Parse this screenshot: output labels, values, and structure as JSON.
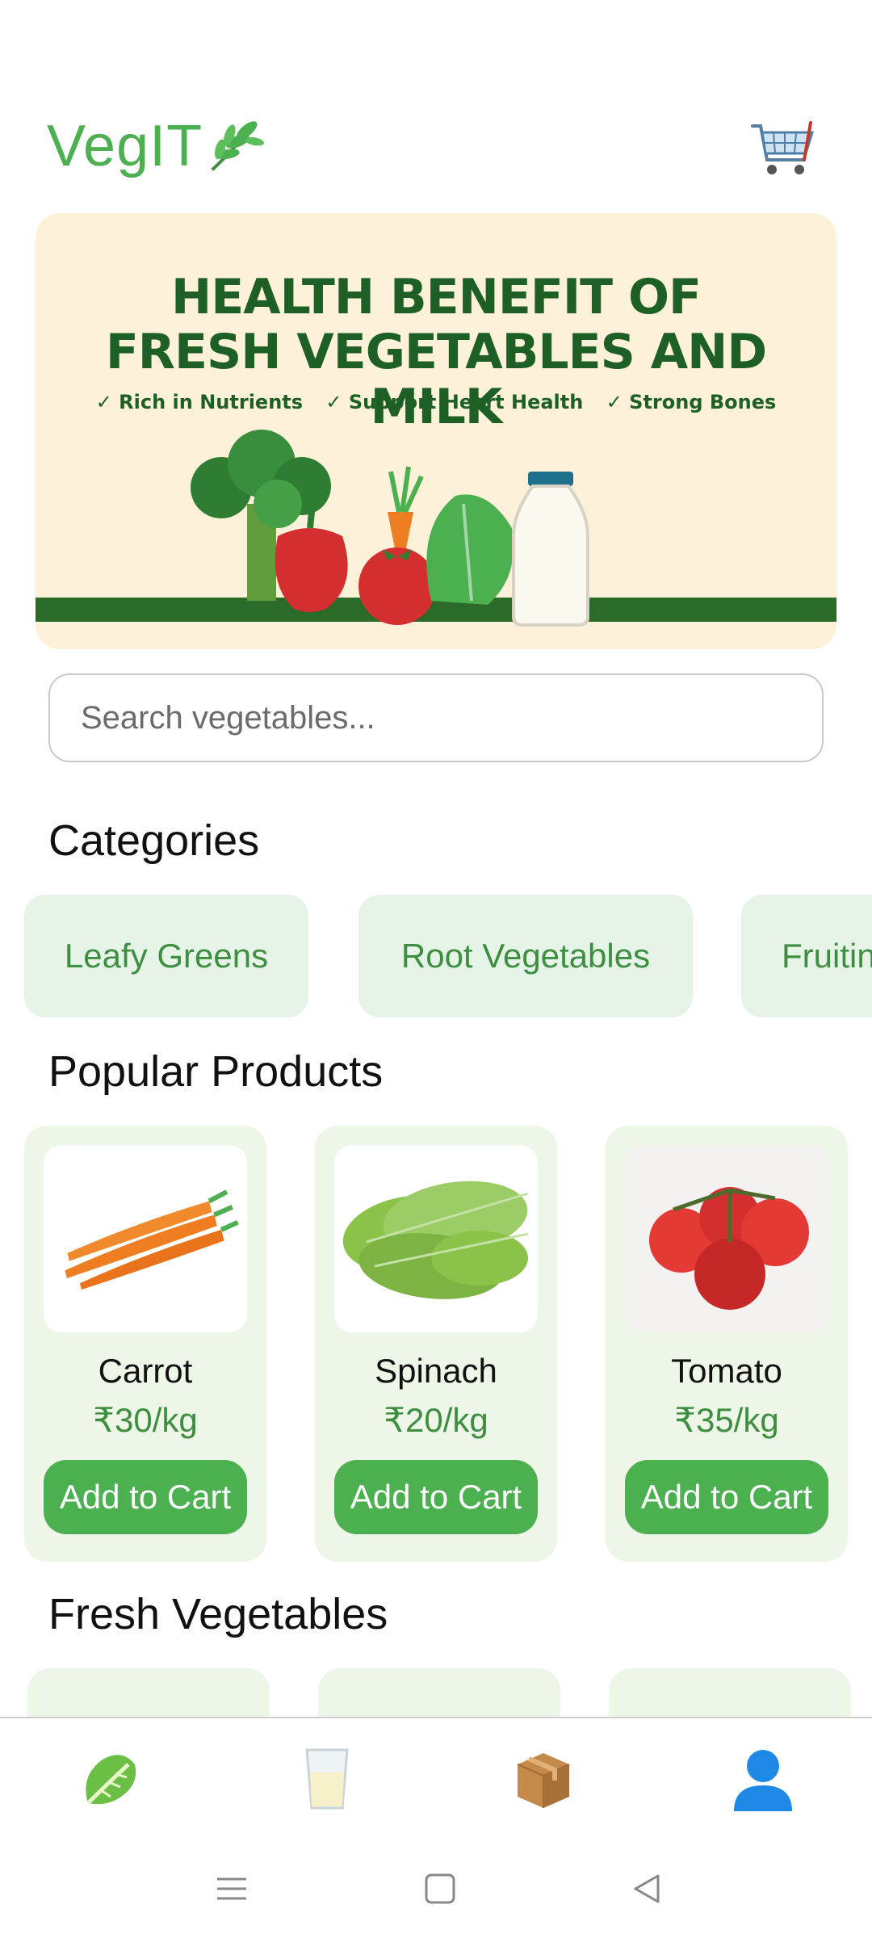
{
  "app": {
    "logo_text": "VegIT"
  },
  "banner": {
    "title_line1": "HEALTH BENEFIT OF",
    "title_line2": "FRESH VEGETABLES AND MILK",
    "checks": [
      "✓ Rich in Nutrients",
      "✓ Support Heart Health",
      "✓ Strong Bones"
    ]
  },
  "search": {
    "placeholder": "Search vegetables..."
  },
  "sections": {
    "categories": "Categories",
    "popular": "Popular Products",
    "fresh": "Fresh Vegetables"
  },
  "categories": [
    {
      "label": "Leafy Greens"
    },
    {
      "label": "Root Vegetables"
    },
    {
      "label": "Fruiting"
    }
  ],
  "products": [
    {
      "name": "Carrot",
      "price": "₹30/kg",
      "button": "Add to Cart",
      "icon": "carrot-image"
    },
    {
      "name": "Spinach",
      "price": "₹20/kg",
      "button": "Add to Cart",
      "icon": "spinach-image"
    },
    {
      "name": "Tomato",
      "price": "₹35/kg",
      "button": "Add to Cart",
      "icon": "tomato-image"
    }
  ],
  "bottom_nav": [
    {
      "icon": "lettuce-icon"
    },
    {
      "icon": "milk-glass-icon"
    },
    {
      "icon": "package-icon"
    },
    {
      "icon": "profile-icon"
    }
  ],
  "colors": {
    "brand_green": "#4caf50",
    "banner_bg": "#fdf1d9",
    "chip_bg": "#e6f4e8",
    "card_bg": "#eef6e8"
  }
}
